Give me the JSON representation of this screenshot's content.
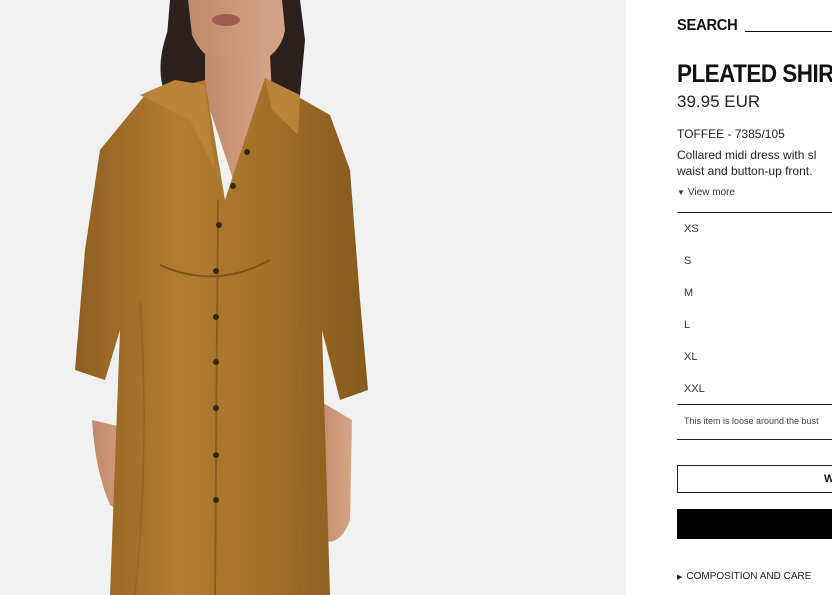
{
  "header": {
    "search_label": "SEARCH"
  },
  "product": {
    "title": "PLEATED SHIRT",
    "price": "39.95 EUR",
    "colour_ref": "TOFFEE - 7385/105",
    "description_line1": "Collared midi dress with sl",
    "description_line2": "waist and button-up front.",
    "view_more": "View more"
  },
  "sizes": [
    "XS",
    "S",
    "M",
    "L",
    "XL",
    "XXL"
  ],
  "size_note": "This item is loose around the bust",
  "buttons": {
    "outline_label": "W"
  },
  "composition": {
    "label": "COMPOSITION AND CARE"
  },
  "colors": {
    "dress": "#a8772a",
    "background": "#f1f1f1",
    "accent": "#000000"
  },
  "icons": {
    "view_more": "caret-down-icon",
    "composition": "caret-right-icon"
  }
}
